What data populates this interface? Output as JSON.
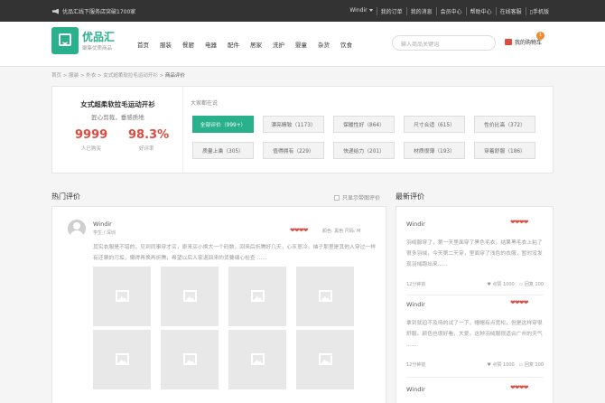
{
  "topbar": {
    "notice": "优品汇线下服务店突破1700家",
    "user": "Windir",
    "links": [
      "我的订单",
      "我的消息",
      "会员中心",
      "帮助中心",
      "在线客服",
      "手机版"
    ]
  },
  "header": {
    "brand": "优品汇",
    "brand_sub": "聚集优质商品",
    "nav": [
      "首页",
      "服装",
      "餐厨",
      "电器",
      "配件",
      "居家",
      "洗护",
      "婴童",
      "杂货",
      "饮食"
    ],
    "search_placeholder": "输入商品关键词",
    "cart_label": "我的购物车",
    "cart_count": "1"
  },
  "breadcrumb": {
    "path": "首页 > 服装 > 外衣 > 女式超柔软拉毛运动开衫 > ",
    "current": "商品评价"
  },
  "summary": {
    "product_name": "女式超柔软拉毛运动开衫",
    "slogan": "匠心剪裁，垂感质地",
    "buyers": "9999",
    "buyers_label": "人已购买",
    "rate": "98.3%",
    "rate_label": "好评率",
    "tags_title": "大家都在说",
    "tags": [
      "全部评价（999+）",
      "漂亮睛致（1173）",
      "保暖性好（864）",
      "尺寸合适（615）",
      "性价比高（372）",
      "质量上乘（305）",
      "值得拥有（229）",
      "快递给力（201）",
      "材质很薄（193）",
      "穿着舒服（186）"
    ],
    "active_tag_index": 0
  },
  "hot": {
    "title": "热门评价",
    "only_images_label": "只显示带图评价",
    "review": {
      "user": "Windir",
      "sub": "学生 / 深圳",
      "hearts": "❤❤❤❤",
      "meta": "颜色: 黑色 尺码: M",
      "text": "其实衣服是不错的，见到同事穿才买，原来买小换大一个码数，回来后折腾好几天，心灰意冷，袖子那里是其他人穿过一样有还票的污垢，懒得再换再折腾，希望以后人家退回来的货要细心检查 ......",
      "image_count": 8
    }
  },
  "latest": {
    "title": "最新评价",
    "items": [
      {
        "user": "Windir",
        "hearts": "❤❤❤❤",
        "text": "羽绒服穿了，第一天里面穿了黑色毛衣，结果黑毛衣上粘了很多羽绒，今天第二天穿，里面穿了浅色的衣服，暂时没发现羽绒跑出来......",
        "time": "12分钟前",
        "likes": "点赞 1000",
        "replies": "回复 100"
      },
      {
        "user": "Windir",
        "hearts": "❤❤❤❤",
        "text": "拿到就迫不及待的试了一下，帽帽有点宽松，但是这样穿很舒服。颜色也很好看，大爱。这种羽绒服很适合广州的天气 ......",
        "time": "12分钟前",
        "likes": "点赞 1000",
        "replies": "回复 100"
      },
      {
        "user": "Windir",
        "hearts": "❤❤❤❤"
      }
    ]
  },
  "colors": {
    "brand_green": "#29b08c",
    "accent_red": "#e04b3f"
  }
}
